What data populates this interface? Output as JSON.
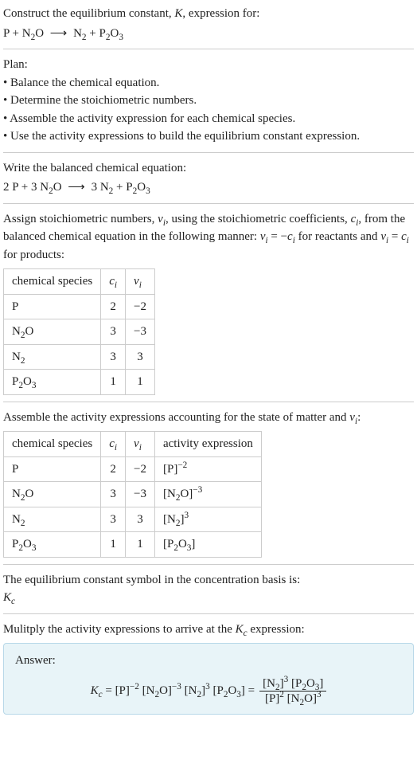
{
  "intro": {
    "line1": "Construct the equilibrium constant, ",
    "kvar": "K",
    "line1b": ", expression for:",
    "eq_lhs": "P + N",
    "eq_sub1": "2",
    "eq_mid1": "O",
    "arrow": "⟶",
    "eq_rhs1": " N",
    "eq_sub2": "2",
    "eq_rhs2": " + P",
    "eq_sub3": "2",
    "eq_rhs3": "O",
    "eq_sub4": "3"
  },
  "plan": {
    "title": "Plan:",
    "b1": "• Balance the chemical equation.",
    "b2": "• Determine the stoichiometric numbers.",
    "b3": "• Assemble the activity expression for each chemical species.",
    "b4": "• Use the activity expressions to build the equilibrium constant expression."
  },
  "balanced": {
    "title": "Write the balanced chemical equation:",
    "lhs1": "2 P + 3 N",
    "sub1": "2",
    "lhs2": "O",
    "arrow": "⟶",
    "rhs1": " 3 N",
    "sub2": "2",
    "rhs2": " + P",
    "sub3": "2",
    "rhs3": "O",
    "sub4": "3"
  },
  "assign": {
    "p1a": "Assign stoichiometric numbers, ",
    "nu": "ν",
    "isub": "i",
    "p1b": ", using the stoichiometric coefficients, ",
    "c": "c",
    "p1c": ", from the balanced chemical equation in the following manner: ",
    "eq1": " = −",
    "p1d": " for reactants and ",
    "eq2": " = ",
    "p1e": " for products:"
  },
  "table1": {
    "h1": "chemical species",
    "h2c": "c",
    "h2i": "i",
    "h3n": "ν",
    "h3i": "i",
    "r1s": "P",
    "r1c": "2",
    "r1n": "−2",
    "r2s1": "N",
    "r2sub": "2",
    "r2s2": "O",
    "r2c": "3",
    "r2n": "−3",
    "r3s1": "N",
    "r3sub": "2",
    "r3c": "3",
    "r3n": "3",
    "r4s1": "P",
    "r4sub1": "2",
    "r4s2": "O",
    "r4sub2": "3",
    "r4c": "1",
    "r4n": "1"
  },
  "assemble": {
    "p1a": "Assemble the activity expressions accounting for the state of matter and ",
    "nu": "ν",
    "isub": "i",
    "p1b": ":"
  },
  "table2": {
    "h1": "chemical species",
    "h2c": "c",
    "h2i": "i",
    "h3n": "ν",
    "h3i": "i",
    "h4": "activity expression",
    "r1s": "P",
    "r1c": "2",
    "r1n": "−2",
    "r1a1": "[P]",
    "r1asup": "−2",
    "r2s1": "N",
    "r2sub": "2",
    "r2s2": "O",
    "r2c": "3",
    "r2n": "−3",
    "r2a1": "[N",
    "r2asub": "2",
    "r2a2": "O]",
    "r2asup": "−3",
    "r3s1": "N",
    "r3sub": "2",
    "r3c": "3",
    "r3n": "3",
    "r3a1": "[N",
    "r3asub": "2",
    "r3a2": "]",
    "r3asup": "3",
    "r4s1": "P",
    "r4sub1": "2",
    "r4s2": "O",
    "r4sub2": "3",
    "r4c": "1",
    "r4n": "1",
    "r4a1": "[P",
    "r4asub1": "2",
    "r4a2": "O",
    "r4asub2": "3",
    "r4a3": "]"
  },
  "symbol": {
    "line1": "The equilibrium constant symbol in the concentration basis is:",
    "kc": "K",
    "kcsub": "c"
  },
  "multiply": {
    "line1a": "Mulitply the activity expressions to arrive at the ",
    "kc": "K",
    "kcsub": "c",
    "line1b": " expression:"
  },
  "answer": {
    "label": "Answer:",
    "kc": "K",
    "kcsub": "c",
    "eq": " = ",
    "t1": "[P]",
    "t1sup": "−2",
    "t2a": " [N",
    "t2sub": "2",
    "t2b": "O]",
    "t2sup": "−3",
    "t3a": " [N",
    "t3sub": "2",
    "t3b": "]",
    "t3sup": "3",
    "t4a": " [P",
    "t4sub1": "2",
    "t4b": "O",
    "t4sub2": "3",
    "t4c": "]",
    "eq2": " = ",
    "num1a": "[N",
    "num1sub": "2",
    "num1b": "]",
    "num1sup": "3",
    "num2a": " [P",
    "num2sub1": "2",
    "num2b": "O",
    "num2sub2": "3",
    "num2c": "]",
    "den1": "[P]",
    "den1sup": "2",
    "den2a": " [N",
    "den2sub": "2",
    "den2b": "O]",
    "den2sup": "3"
  }
}
